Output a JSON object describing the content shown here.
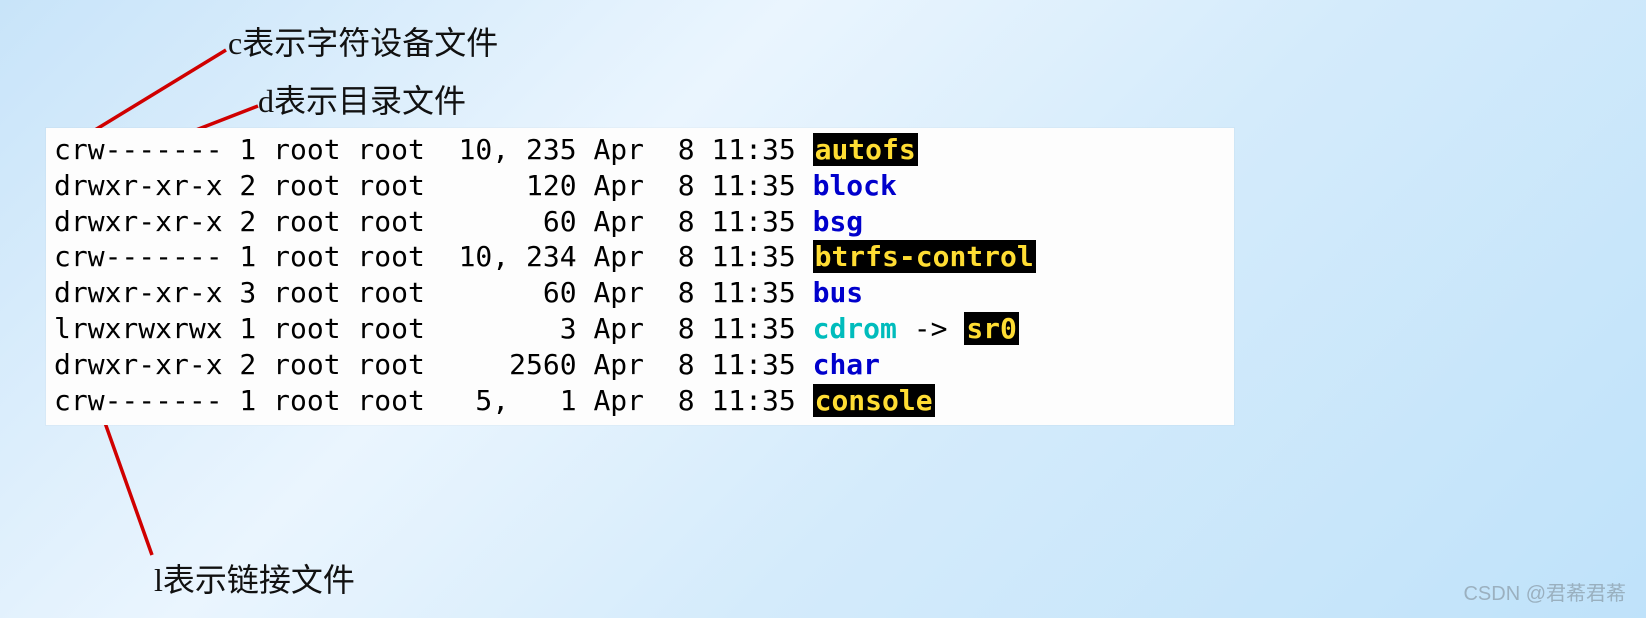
{
  "annotations": {
    "c_char_device": "c表示字符设备文件",
    "d_directory": "d表示目录文件",
    "l_link": "l表示链接文件"
  },
  "listing": {
    "columns_meta": [
      "perms",
      "links",
      "owner",
      "group",
      "size_or_major_minor",
      "month",
      "day",
      "time",
      "name",
      "link_target"
    ],
    "rows": [
      {
        "perms": "crw-------",
        "links": "1",
        "owner": "root",
        "group": "root",
        "size": "10, 235",
        "month": "Apr",
        "day": "8",
        "time": "11:35",
        "name": "autofs",
        "ftype": "cdev"
      },
      {
        "perms": "drwxr-xr-x",
        "links": "2",
        "owner": "root",
        "group": "root",
        "size": "120",
        "month": "Apr",
        "day": "8",
        "time": "11:35",
        "name": "block",
        "ftype": "dir"
      },
      {
        "perms": "drwxr-xr-x",
        "links": "2",
        "owner": "root",
        "group": "root",
        "size": "60",
        "month": "Apr",
        "day": "8",
        "time": "11:35",
        "name": "bsg",
        "ftype": "dir"
      },
      {
        "perms": "crw-------",
        "links": "1",
        "owner": "root",
        "group": "root",
        "size": "10, 234",
        "month": "Apr",
        "day": "8",
        "time": "11:35",
        "name": "btrfs-control",
        "ftype": "cdev"
      },
      {
        "perms": "drwxr-xr-x",
        "links": "3",
        "owner": "root",
        "group": "root",
        "size": "60",
        "month": "Apr",
        "day": "8",
        "time": "11:35",
        "name": "bus",
        "ftype": "dir"
      },
      {
        "perms": "lrwxrwxrwx",
        "links": "1",
        "owner": "root",
        "group": "root",
        "size": "3",
        "month": "Apr",
        "day": "8",
        "time": "11:35",
        "name": "cdrom",
        "ftype": "link",
        "target": "sr0",
        "target_ftype": "cdev"
      },
      {
        "perms": "drwxr-xr-x",
        "links": "2",
        "owner": "root",
        "group": "root",
        "size": "2560",
        "month": "Apr",
        "day": "8",
        "time": "11:35",
        "name": "char",
        "ftype": "dir"
      },
      {
        "perms": "crw-------",
        "links": "1",
        "owner": "root",
        "group": "root",
        "size": "5,   1",
        "month": "Apr",
        "day": "8",
        "time": "11:35",
        "name": "console",
        "ftype": "cdev"
      }
    ]
  },
  "watermark": "CSDN @君莃君莃"
}
